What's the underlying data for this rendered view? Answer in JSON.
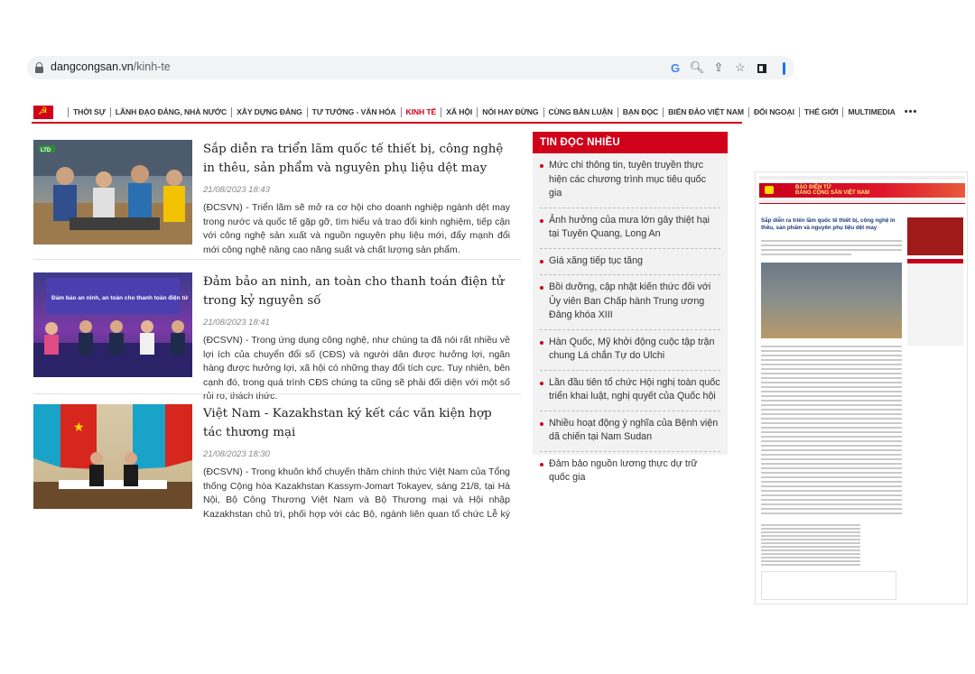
{
  "browser": {
    "url_domain": "dangcongsan.vn",
    "url_path": "/kinh-te",
    "icons": [
      "google-lens-icon",
      "zoom-icon",
      "share-icon",
      "bookmark-star-icon",
      "sidebar-icon",
      "profile-icon"
    ]
  },
  "nav": {
    "items": [
      {
        "label": "THỜI SỰ",
        "active": false
      },
      {
        "label": "LÃNH ĐẠO ĐẢNG, NHÀ NƯỚC",
        "active": false
      },
      {
        "label": "XÂY DỰNG ĐẢNG",
        "active": false
      },
      {
        "label": "TƯ TƯỞNG - VĂN HÓA",
        "active": false
      },
      {
        "label": "KINH TẾ",
        "active": true
      },
      {
        "label": "XÃ HỘI",
        "active": false
      },
      {
        "label": "NÓI HAY ĐỪNG",
        "active": false
      },
      {
        "label": "CÙNG BÀN LUẬN",
        "active": false
      },
      {
        "label": "BẠN ĐỌC",
        "active": false
      },
      {
        "label": "BIỂN ĐẢO VIỆT NAM",
        "active": false
      },
      {
        "label": "ĐỐI NGOẠI",
        "active": false
      },
      {
        "label": "THẾ GIỚI",
        "active": false
      },
      {
        "label": "MULTIMEDIA",
        "active": false
      }
    ],
    "more": "•••",
    "accent_color": "#d0021b"
  },
  "articles": [
    {
      "title": "Sắp diễn ra triển lãm quốc tế thiết bị, công nghệ in thêu, sản phẩm và nguyên phụ liệu dệt may",
      "date": "21/08/2023 18:43",
      "summary": "(ĐCSVN) - Triển lãm sẽ mở ra cơ hội cho doanh nghiệp ngành dệt may trong nước và quốc tế gặp gỡ, tìm hiểu và trao đổi kinh nghiệm, tiếp cận với công nghệ sản xuất và nguồn nguyên phụ liệu mới, đẩy mạnh đổi mới công nghệ nâng cao năng suất và chất lượng sản phẩm.",
      "thumb_label": "LTD"
    },
    {
      "title": "Đảm bảo an ninh, an toàn cho thanh toán điện tử trong kỷ nguyên số",
      "date": "21/08/2023 18:41",
      "summary": "(ĐCSVN) - Trong ứng dụng công nghệ, như chúng ta đã nói rất nhiều về lợi ích của chuyển đổi số (CĐS) và người dân được hưởng lợi, ngân hàng được hưởng lợi, xã hội có những thay đổi tích cực. Tuy nhiên, bên cạnh đó, trong quá trình CĐS chúng ta cũng sẽ phải đối diện với một số rủi ro, thách thức.",
      "thumb_label": "Đảm bảo an ninh, an toàn cho thanh toán điện tử"
    },
    {
      "title": "Việt Nam - Kazakhstan ký kết các văn kiện hợp tác thương mại",
      "date": "21/08/2023 18:30",
      "summary": "(ĐCSVN) - Trong khuôn khổ chuyến thăm chính thức Việt Nam của Tổng thống Cộng hòa Kazakhstan Kassym-Jomart Tokayev, sáng 21/8, tại Hà Nội, Bộ Công Thương Việt Nam và Bộ Thương mại và Hội nhập Kazakhstan chủ trì, phối hợp với các Bộ, ngành liên quan tổ chức Lễ ký kết các văn kiện",
      "thumb_label": ""
    }
  ],
  "most_read": {
    "heading": "TIN ĐỌC NHIỀU",
    "items": [
      "Mức chi thông tin, tuyên truyền thực hiện các chương trình mục tiêu quốc gia",
      "Ảnh hưởng của mưa lớn gây thiệt hại tại Tuyên Quang, Long An",
      "Giá xăng tiếp tục tăng",
      "Bồi dưỡng, cập nhật kiến thức đối với Ủy viên Ban Chấp hành Trung ương Đảng khóa XIII",
      "Hàn Quốc, Mỹ khởi động cuộc tập trận chung Lá chắn Tự do Ulchi",
      "Lần đầu tiên tổ chức Hội nghị toàn quốc triển khai luật, nghị quyết của Quốc hội",
      "Nhiều hoạt động ý nghĩa của Bệnh viện dã chiến tại Nam Sudan",
      "Đảm bảo nguồn lương thực dự trữ quốc gia"
    ]
  },
  "mini_page": {
    "banner_line1": "BÁO ĐIỆN TỬ",
    "banner_line2": "ĐẢNG CỘNG SẢN VIỆT NAM",
    "title": "Sắp diễn ra triển lãm quốc tế thiết bị, công nghệ in thêu, sản phẩm và nguyên phụ liệu dệt may"
  }
}
